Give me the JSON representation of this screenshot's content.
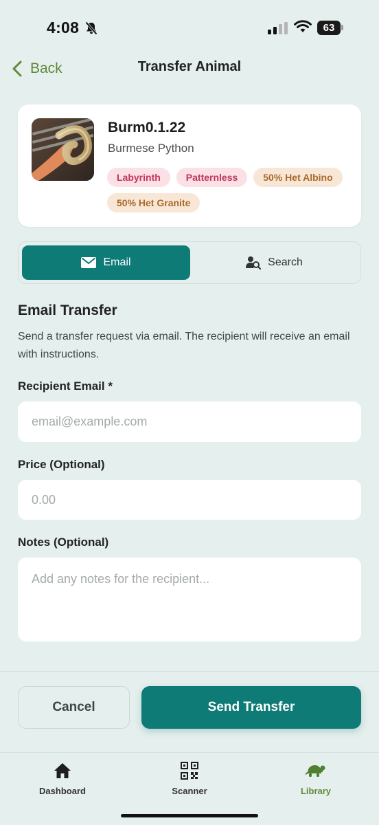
{
  "status_bar": {
    "time": "4:08",
    "battery": "63"
  },
  "nav": {
    "back_label": "Back",
    "title": "Transfer Animal"
  },
  "animal": {
    "name": "Burm0.1.22",
    "species": "Burmese Python",
    "tags": [
      {
        "label": "Labyrinth",
        "color": "#c0355a"
      },
      {
        "label": "Patternless",
        "color": "#c0355a"
      },
      {
        "label": "50% Het Albino",
        "color": "#a9692a"
      },
      {
        "label": "50% Het Granite",
        "color": "#a9692a"
      }
    ]
  },
  "segment": {
    "email_label": "Email",
    "search_label": "Search",
    "active": "Email"
  },
  "form": {
    "title": "Email Transfer",
    "description": "Send a transfer request via email. The recipient will receive an email with instructions.",
    "email_label": "Recipient Email *",
    "email_placeholder": "email@example.com",
    "email_value": "",
    "price_label": "Price (Optional)",
    "price_placeholder": "0.00",
    "price_value": "",
    "notes_label": "Notes (Optional)",
    "notes_placeholder": "Add any notes for the recipient...",
    "notes_value": ""
  },
  "actions": {
    "cancel_label": "Cancel",
    "send_label": "Send Transfer"
  },
  "tabbar": {
    "items": [
      {
        "label": "Dashboard",
        "icon": "home-icon"
      },
      {
        "label": "Scanner",
        "icon": "qr-code-icon"
      },
      {
        "label": "Library",
        "icon": "turtle-icon"
      }
    ],
    "active": "Library"
  },
  "colors": {
    "accent": "#0e7b77",
    "back_green": "#5f8a3a",
    "background": "#e5efed"
  }
}
